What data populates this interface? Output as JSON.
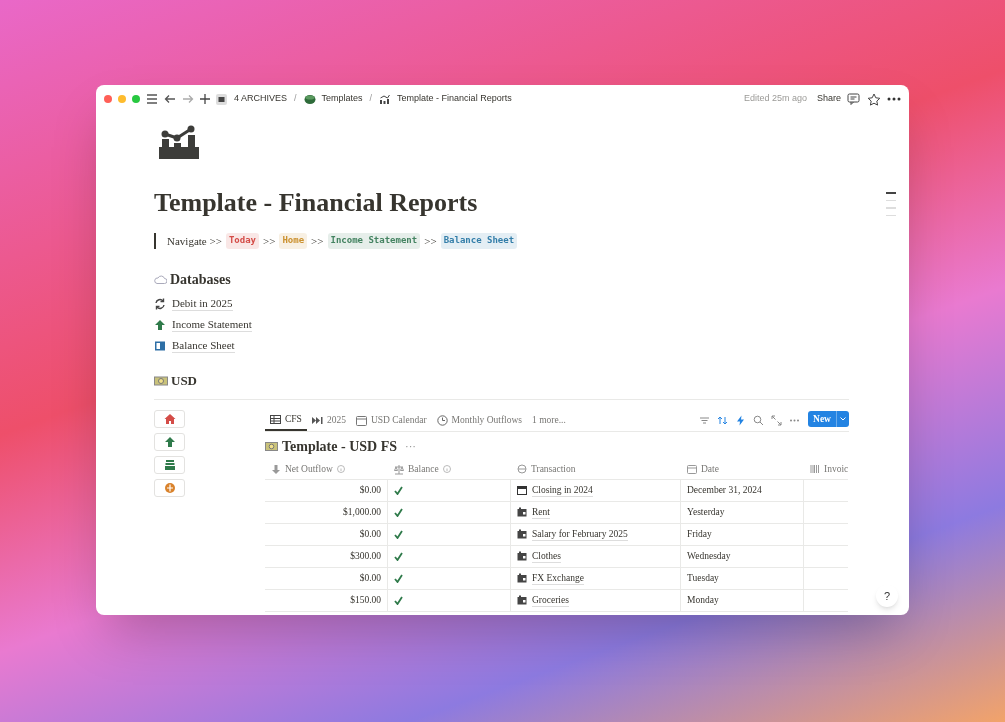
{
  "window": {
    "breadcrumbs": [
      "4 ARCHIVES",
      "Templates",
      "Template - Financial Reports"
    ],
    "separator": "/",
    "edited": "Edited 25m ago",
    "share": "Share"
  },
  "page": {
    "title": "Template - Financial Reports",
    "navigate": "Navigate >>",
    "nav_links": [
      {
        "label": "Today",
        "color": "#d44c47"
      },
      {
        "label": "Home",
        "color": "#cb912f"
      },
      {
        "label": "Income Statement",
        "color": "#448361"
      },
      {
        "label": "Balance Sheet",
        "color": "#337ea9"
      }
    ],
    "separator": ">>"
  },
  "databases": {
    "heading": "Databases",
    "items": [
      {
        "label": "Debit in 2025",
        "kind": "cycle"
      },
      {
        "label": "Income Statement",
        "kind": "up"
      },
      {
        "label": "Balance Sheet",
        "kind": "book"
      }
    ]
  },
  "usd": {
    "heading": "USD"
  },
  "view": {
    "tabs": [
      {
        "label": "CFS",
        "kind": "table",
        "selected": true
      },
      {
        "label": "2025",
        "kind": "forward",
        "selected": false
      },
      {
        "label": "USD Calendar",
        "kind": "calendar",
        "selected": false
      },
      {
        "label": "Monthly Outflows",
        "kind": "chart",
        "selected": false
      },
      {
        "label": "1 more...",
        "kind": "more",
        "selected": false
      }
    ],
    "new_button": "New",
    "title": "Template - USD FS",
    "more": "···",
    "columns": [
      "Net Outflow",
      "Balance",
      "Transaction",
      "Date",
      "Invoic"
    ],
    "rows": [
      {
        "net_outflow": "$0.00",
        "balance": true,
        "transaction": "Closing in 2024",
        "kind": "calendar",
        "date": "December 31, 2024"
      },
      {
        "net_outflow": "$1,000.00",
        "balance": true,
        "transaction": "Rent",
        "kind": "entry",
        "date": "Yesterday"
      },
      {
        "net_outflow": "$0.00",
        "balance": true,
        "transaction": "Salary for February 2025",
        "kind": "entry",
        "date": "Friday"
      },
      {
        "net_outflow": "$300.00",
        "balance": true,
        "transaction": "Clothes",
        "kind": "entry",
        "date": "Wednesday"
      },
      {
        "net_outflow": "$0.00",
        "balance": true,
        "transaction": "FX Exchange",
        "kind": "entry",
        "date": "Tuesday"
      },
      {
        "net_outflow": "$150.00",
        "balance": true,
        "transaction": "Groceries",
        "kind": "entry",
        "date": "Monday"
      }
    ]
  },
  "help": "?"
}
